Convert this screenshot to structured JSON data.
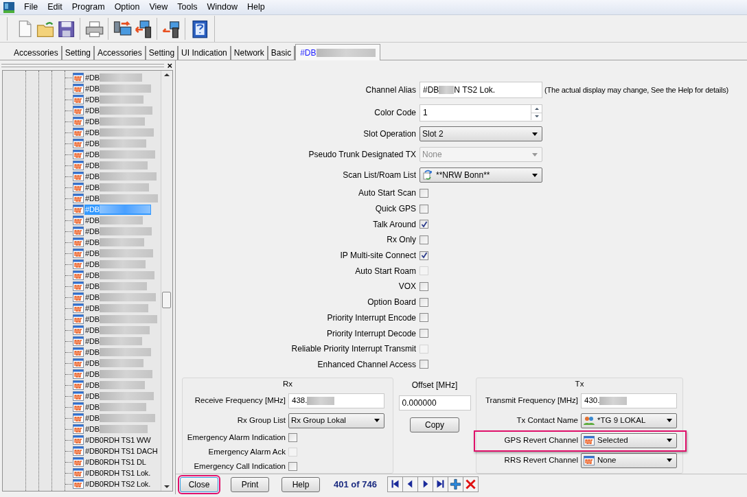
{
  "menu": [
    "File",
    "Edit",
    "Program",
    "Option",
    "View",
    "Tools",
    "Window",
    "Help"
  ],
  "tabs": [
    {
      "label": "Accessories",
      "selected": false,
      "blurred": false
    },
    {
      "label": "Setting",
      "selected": false,
      "blurred": false
    },
    {
      "label": "Accessories",
      "selected": false,
      "blurred": false
    },
    {
      "label": "Setting",
      "selected": false,
      "blurred": false
    },
    {
      "label": "UI Indication",
      "selected": false,
      "blurred": false
    },
    {
      "label": "Network",
      "selected": false,
      "blurred": false
    },
    {
      "label": "Basic",
      "selected": false,
      "blurred": false
    },
    {
      "label": "#DB",
      "selected": true,
      "blurred": true
    }
  ],
  "tree": {
    "close": "×",
    "items": [
      {
        "label": "#DB",
        "blurred": true,
        "selected": false
      },
      {
        "label": "#DB",
        "blurred": true,
        "selected": false
      },
      {
        "label": "#DB",
        "blurred": true,
        "selected": false
      },
      {
        "label": "#DB",
        "blurred": true,
        "selected": false
      },
      {
        "label": "#DB",
        "blurred": true,
        "selected": false
      },
      {
        "label": "#DB",
        "blurred": true,
        "selected": false
      },
      {
        "label": "#DB",
        "blurred": true,
        "selected": false
      },
      {
        "label": "#DB",
        "blurred": true,
        "selected": false
      },
      {
        "label": "#DB",
        "blurred": true,
        "selected": false
      },
      {
        "label": "#DB",
        "blurred": true,
        "selected": false
      },
      {
        "label": "#DB",
        "blurred": true,
        "selected": false
      },
      {
        "label": "#DB",
        "blurred": true,
        "selected": false
      },
      {
        "label": "#DB",
        "blurred": true,
        "selected": true
      },
      {
        "label": "#DB",
        "blurred": true,
        "selected": false
      },
      {
        "label": "#DB",
        "blurred": true,
        "selected": false
      },
      {
        "label": "#DB",
        "blurred": true,
        "selected": false
      },
      {
        "label": "#DB",
        "blurred": true,
        "selected": false
      },
      {
        "label": "#DB",
        "blurred": true,
        "selected": false
      },
      {
        "label": "#DB",
        "blurred": true,
        "selected": false
      },
      {
        "label": "#DB",
        "blurred": true,
        "selected": false
      },
      {
        "label": "#DB",
        "blurred": true,
        "selected": false
      },
      {
        "label": "#DB",
        "blurred": true,
        "selected": false
      },
      {
        "label": "#DB",
        "blurred": true,
        "selected": false
      },
      {
        "label": "#DB",
        "blurred": true,
        "selected": false
      },
      {
        "label": "#DB",
        "blurred": true,
        "selected": false
      },
      {
        "label": "#DB",
        "blurred": true,
        "selected": false
      },
      {
        "label": "#DB",
        "blurred": true,
        "selected": false
      },
      {
        "label": "#DB",
        "blurred": true,
        "selected": false
      },
      {
        "label": "#DB",
        "blurred": true,
        "selected": false
      },
      {
        "label": "#DB",
        "blurred": true,
        "selected": false
      },
      {
        "label": "#DB",
        "blurred": true,
        "selected": false
      },
      {
        "label": "#DB",
        "blurred": true,
        "selected": false
      },
      {
        "label": "#DB",
        "blurred": true,
        "selected": false
      },
      {
        "label": "#DB0RDH TS1 WW",
        "blurred": false,
        "selected": false
      },
      {
        "label": "#DB0RDH TS1 DACH",
        "blurred": false,
        "selected": false
      },
      {
        "label": "#DB0RDH TS1 DL",
        "blurred": false,
        "selected": false
      },
      {
        "label": "#DB0RDH TS1 Lok.",
        "blurred": false,
        "selected": false
      },
      {
        "label": "#DB0RDH TS2 Lok.",
        "blurred": false,
        "selected": false
      }
    ]
  },
  "form": {
    "rows": [
      {
        "kind": "alias",
        "label": "Channel Alias",
        "value": "#DB",
        "value_end": "N TS2 Lok.",
        "note": "(The actual display may change, See the Help for details)"
      },
      {
        "kind": "spin",
        "label": "Color Code",
        "value": "1"
      },
      {
        "kind": "select",
        "label": "Slot Operation",
        "value": "Slot 2",
        "disabled": false
      },
      {
        "kind": "select",
        "label": "Pseudo Trunk Designated TX",
        "value": "None",
        "disabled": true
      },
      {
        "kind": "select",
        "label": "Scan List/Roam List",
        "value": "**NRW Bonn**",
        "disabled": false
      },
      {
        "kind": "check",
        "label": "Auto Start Scan",
        "checked": false,
        "disabled": false
      },
      {
        "kind": "check",
        "label": "Quick GPS",
        "checked": false,
        "disabled": false
      },
      {
        "kind": "check",
        "label": "Talk Around",
        "checked": true,
        "disabled": false
      },
      {
        "kind": "check",
        "label": "Rx Only",
        "checked": false,
        "disabled": false
      },
      {
        "kind": "check",
        "label": "IP Multi-site Connect",
        "checked": true,
        "disabled": false
      },
      {
        "kind": "check",
        "label": "Auto Start Roam",
        "checked": false,
        "disabled": true
      },
      {
        "kind": "check",
        "label": "VOX",
        "checked": false,
        "disabled": false
      },
      {
        "kind": "check",
        "label": "Option Board",
        "checked": false,
        "disabled": false
      },
      {
        "kind": "check",
        "label": "Priority Interrupt Encode",
        "checked": false,
        "disabled": false
      },
      {
        "kind": "check",
        "label": "Priority Interrupt Decode",
        "checked": false,
        "disabled": false
      },
      {
        "kind": "check",
        "label": "Reliable Priority Interrupt Transmit",
        "checked": false,
        "disabled": true
      },
      {
        "kind": "check",
        "label": "Enhanced Channel Access",
        "checked": false,
        "disabled": false
      }
    ]
  },
  "rx": {
    "title": "Rx",
    "rows": [
      {
        "kind": "freq",
        "label": "Receive Frequency [MHz]",
        "value": "438."
      },
      {
        "kind": "select",
        "label": "Rx Group List",
        "value": "Rx Group Lokal",
        "highlighted": false
      },
      {
        "kind": "check",
        "label": "Emergency Alarm Indication",
        "checked": false,
        "disabled": false
      },
      {
        "kind": "check",
        "label": "Emergency Alarm Ack",
        "checked": false,
        "disabled": true
      },
      {
        "kind": "check",
        "label": "Emergency Call Indication",
        "checked": false,
        "disabled": false
      }
    ]
  },
  "offset": {
    "title": "Offset [MHz]",
    "value": "0.000000",
    "button": "Copy"
  },
  "tx": {
    "title": "Tx",
    "rows": [
      {
        "kind": "freq",
        "label": "Transmit Frequency [MHz]",
        "value": "430."
      },
      {
        "kind": "select",
        "label": "Tx Contact Name",
        "value": "*TG 9 LOKAL",
        "highlighted": false
      },
      {
        "kind": "select",
        "label": "GPS Revert Channel",
        "value": "Selected",
        "highlighted": true
      },
      {
        "kind": "select",
        "label": "RRS Revert Channel",
        "value": "None",
        "highlighted": false
      }
    ]
  },
  "footer": {
    "buttons": [
      {
        "label": "Close",
        "highlighted": true
      },
      {
        "label": "Print",
        "highlighted": false
      },
      {
        "label": "Help",
        "highlighted": false
      }
    ],
    "counter": "401 of 746"
  }
}
